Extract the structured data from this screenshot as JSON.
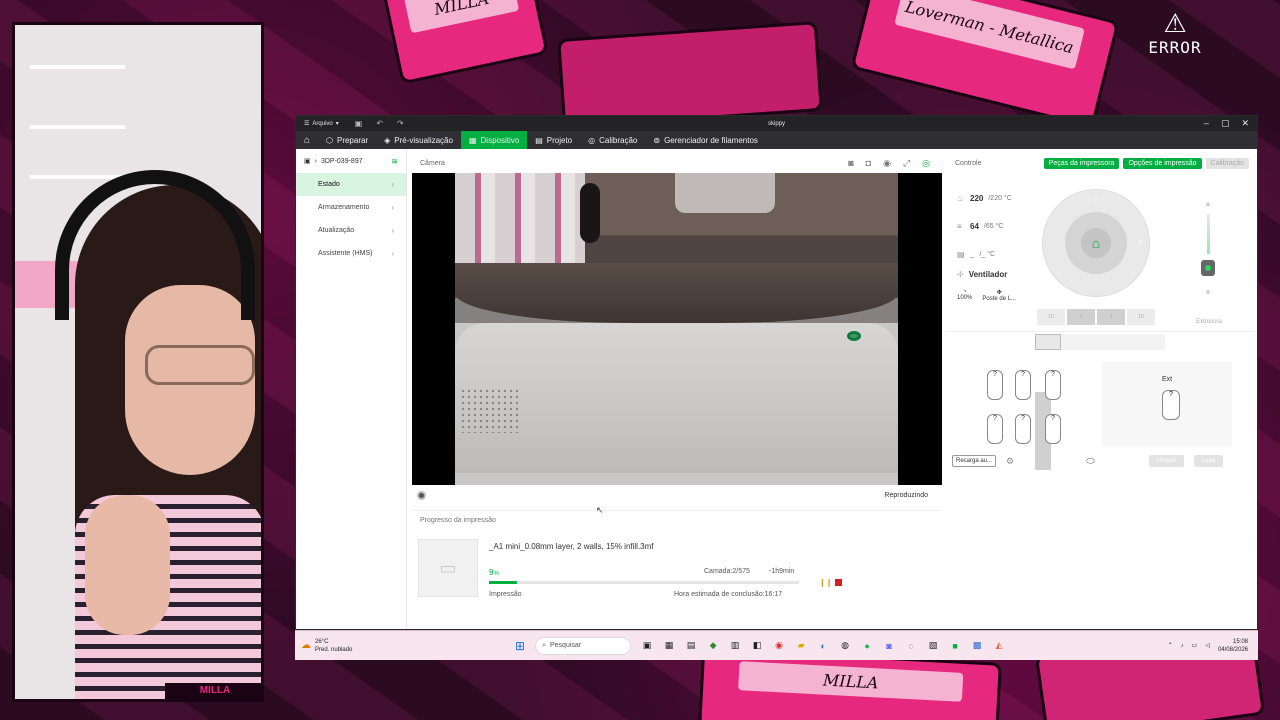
{
  "overlay": {
    "tape_label_1": "Loverman - Metallica",
    "tape_small_1": "MILLA",
    "tape_small_2": "MILLA",
    "error_text": "ERROR",
    "webcam_label": "MILLA"
  },
  "window": {
    "title": "skippy",
    "menu_label": "Arquivo"
  },
  "nav": {
    "tabs": [
      {
        "label": "Preparar",
        "icon": "cube-icon"
      },
      {
        "label": "Pré-visualização",
        "icon": "layers-icon"
      },
      {
        "label": "Dispositivo",
        "icon": "device-icon",
        "active": true
      },
      {
        "label": "Projeto",
        "icon": "project-icon"
      },
      {
        "label": "Calibração",
        "icon": "calibration-icon"
      },
      {
        "label": "Gerenciador de filamentos",
        "icon": "filament-icon"
      }
    ]
  },
  "sidebar": {
    "printer_name": "3DP-039-897",
    "items": [
      {
        "label": "Estado",
        "active": true
      },
      {
        "label": "Armazenamento"
      },
      {
        "label": "Atualização"
      },
      {
        "label": "Assistente (HMS)"
      }
    ]
  },
  "camera": {
    "title": "Câmera",
    "playback_status": "Reproduzindo"
  },
  "progress": {
    "title": "Progresso da impressão",
    "file_name": "_A1 mini_0.08mm layer, 2 walls, 15% infill.3mf",
    "percent_value": 9,
    "percent_label": "9",
    "percent_suffix": "%",
    "layer": "Camada:2/575",
    "remaining": "-1h9min",
    "state": "Impressão",
    "finish_time": "Hora estimada de conclusão:16:17"
  },
  "control": {
    "title": "Controle",
    "btn_parts": "Peças da impressora",
    "btn_options": "Opções de impressão",
    "btn_calibration": "Calibração",
    "nozzle_temp": "220",
    "nozzle_target": "/220 °C",
    "bed_temp": "64",
    "bed_target": "/65 °C",
    "chamber_temp": "_",
    "chamber_target": "/_ °C",
    "fan_title": "Ventilador",
    "fan_speed": "100%",
    "fan_name": "Poste de L...",
    "jog_x_plus": "X",
    "jog_y_plus": "Y",
    "z_labels": [
      "10",
      "1",
      "1",
      "10"
    ],
    "extruder_label": "Extrusora"
  },
  "ams": {
    "ext_label": "Ext",
    "reload_button": "Recarga au...",
    "unload_button": "Unload",
    "load_button": "Load"
  },
  "taskbar": {
    "weather_temp": "26°C",
    "weather_desc": "Pred. nublado",
    "search_placeholder": "Pesquisar",
    "time": "15:08",
    "date": "04/08/2026"
  },
  "colors": {
    "accent": "#00ae42",
    "stop": "#d42020",
    "pause": "#e69a2e"
  }
}
